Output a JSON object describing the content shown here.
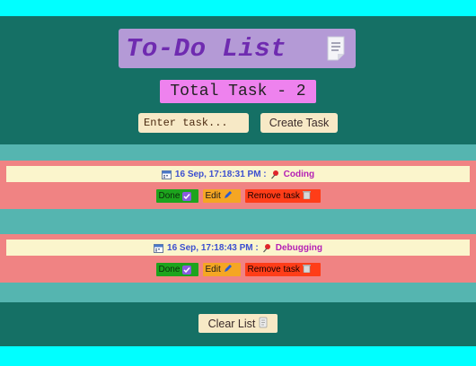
{
  "header": {
    "title": "To-Do List",
    "icon": "note-icon"
  },
  "counter": {
    "text": "Total Task - 2"
  },
  "form": {
    "input_placeholder": "Enter task...",
    "create_label": "Create Task"
  },
  "tasks": [
    {
      "timestamp": "16 Sep, 17:18:31 PM :",
      "name": "Coding",
      "done_label": "Done",
      "edit_label": "Edit",
      "remove_label": "Remove task"
    },
    {
      "timestamp": "16 Sep, 17:18:43 PM :",
      "name": "Debugging",
      "done_label": "Done",
      "edit_label": "Edit",
      "remove_label": "Remove task"
    }
  ],
  "footer": {
    "clear_label": "Clear List"
  },
  "colors": {
    "page_bg": "#00ffff",
    "app_bg": "#157065",
    "header_bg": "#b49ad6",
    "title_color": "#6f2bb0",
    "counter_bg": "#ee82ee",
    "task_area_bg": "#55b5b0",
    "task_bg": "#f08383",
    "done": "#1da41d",
    "edit": "#f5a623",
    "remove": "#ff3d18"
  }
}
